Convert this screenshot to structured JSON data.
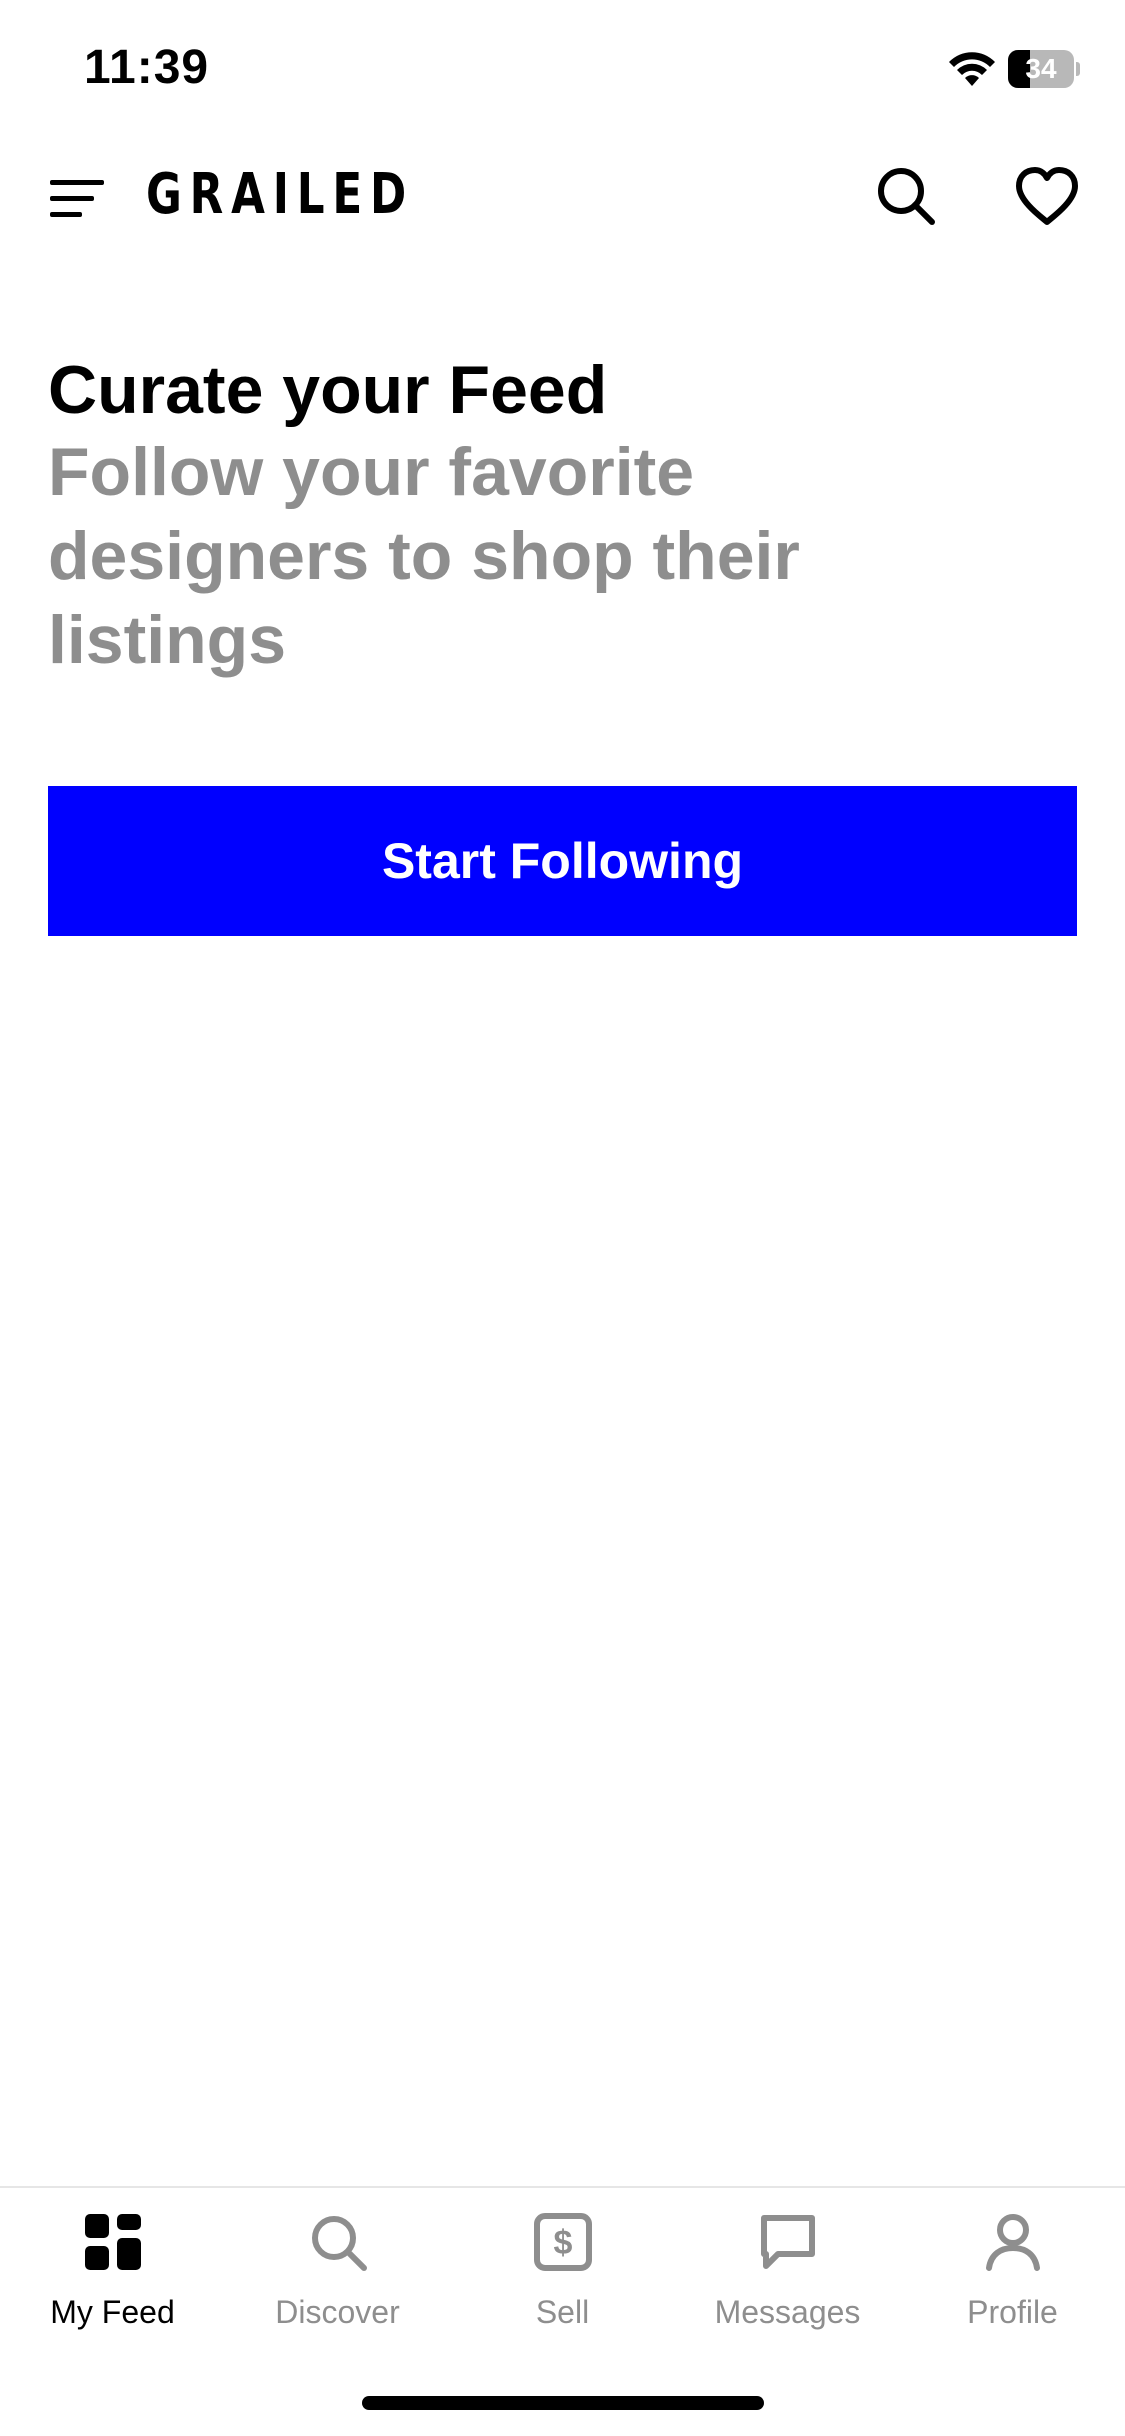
{
  "status_bar": {
    "time": "11:39",
    "battery_level": "34",
    "battery_fraction": 0.34
  },
  "header": {
    "brand": "GRAILED",
    "icons": [
      "menu-icon",
      "search-icon",
      "heart-icon"
    ]
  },
  "main": {
    "title": "Curate your Feed",
    "subtitle": "Follow your favorite designers to shop their listings",
    "cta_label": "Start Following"
  },
  "tab_bar": {
    "tabs": [
      {
        "label": "My Feed",
        "icon": "grid-icon",
        "active": true
      },
      {
        "label": "Discover",
        "icon": "search-icon",
        "active": false
      },
      {
        "label": "Sell",
        "icon": "dollar-icon",
        "active": false
      },
      {
        "label": "Messages",
        "icon": "message-icon",
        "active": false
      },
      {
        "label": "Profile",
        "icon": "person-icon",
        "active": false
      }
    ]
  },
  "colors": {
    "accent": "#0000ff",
    "text_primary": "#000000",
    "text_secondary": "#8e8e8e",
    "background": "#ffffff"
  }
}
